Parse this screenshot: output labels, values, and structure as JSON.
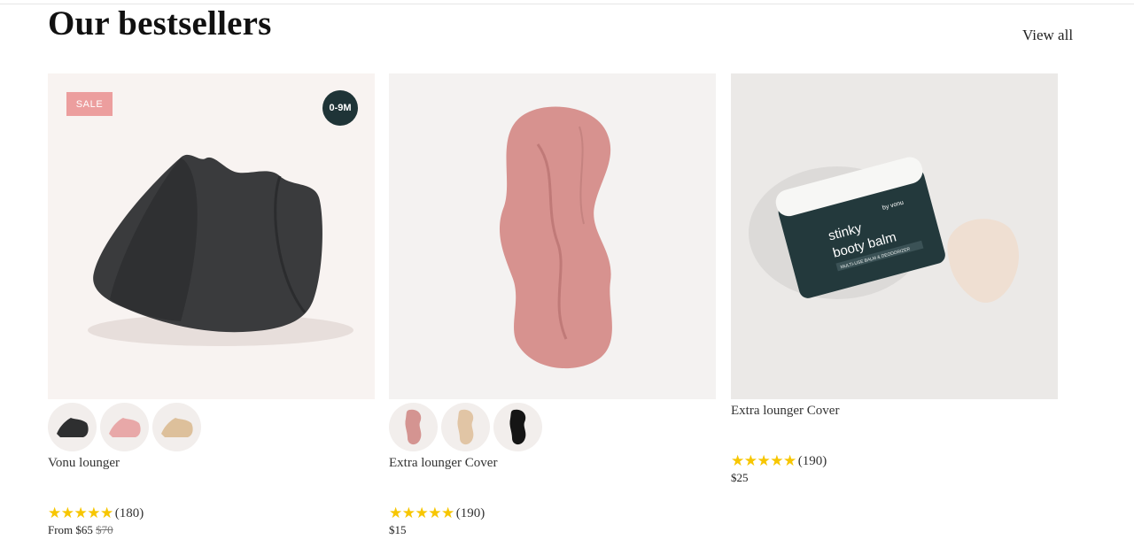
{
  "section": {
    "title": "Our bestsellers",
    "view_all": "View all"
  },
  "products": [
    {
      "badge_sale": "SALE",
      "badge_age": "0-9M",
      "swatches": [
        "charcoal-lounger-swatch",
        "pink-lounger-swatch",
        "tan-lounger-swatch"
      ],
      "name": "Vonu lounger",
      "rating_stars": "★★★★★",
      "rating_count": "(180)",
      "price_prefix": "From $65",
      "price_compare": "$70"
    },
    {
      "swatches": [
        "pink-cover-swatch",
        "beige-cover-swatch",
        "black-cover-swatch"
      ],
      "name": "Extra lounger Cover",
      "rating_stars": "★★★★★",
      "rating_count": "(190)",
      "price": "$15"
    },
    {
      "jar_label": {
        "line1": "stinky",
        "line2": "booty balm",
        "brand": "by vonu",
        "tag": "MULTI-USE BALM & DEODORIZER"
      },
      "name": "Extra lounger Cover",
      "rating_stars": "★★★★★",
      "rating_count": "(190)",
      "price": "$25"
    }
  ]
}
